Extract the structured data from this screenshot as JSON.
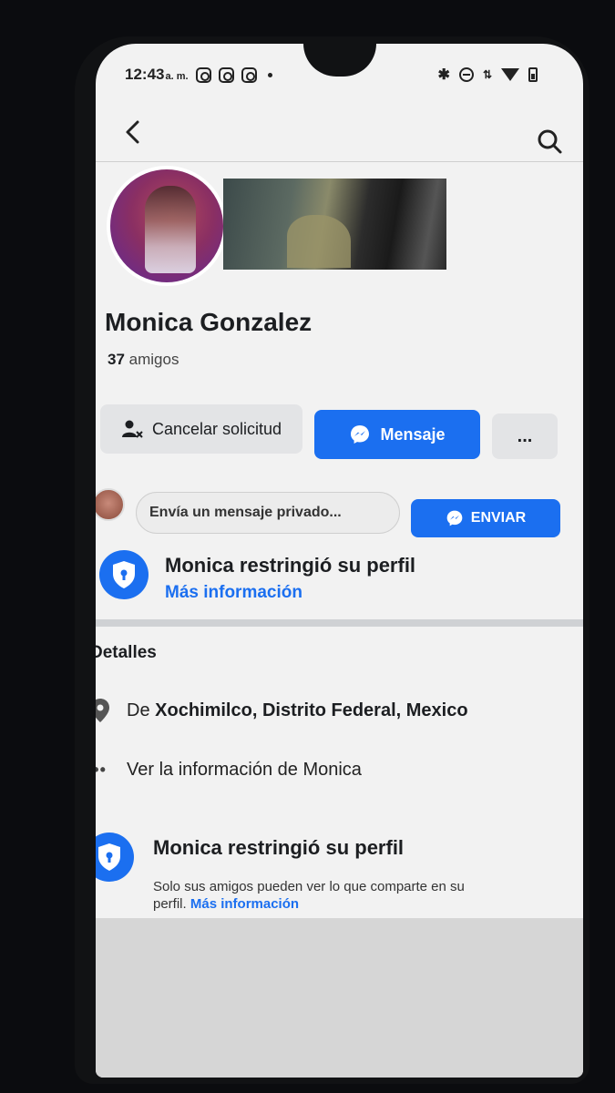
{
  "status_bar": {
    "time": "12:43",
    "ampm": "a. m."
  },
  "profile": {
    "name": "Monica Gonzalez",
    "friends_count": "37",
    "friends_label": "amigos"
  },
  "actions": {
    "cancel_request": "Cancelar solicitud",
    "message": "Mensaje",
    "more": "..."
  },
  "private_message": {
    "placeholder": "Envía un mensaje privado...",
    "send": "ENVIAR"
  },
  "restriction_banner": {
    "title": "Monica restringió su perfil",
    "link": "Más información"
  },
  "details": {
    "title": "Detalles",
    "location_prefix": "De",
    "location": "Xochimilco, Distrito Federal, Mexico",
    "see_info": "Ver la información de Monica"
  },
  "restriction_footer": {
    "title": "Monica restringió su perfil",
    "description": "Solo sus amigos pueden ver lo que comparte en su perfil.",
    "link": "Más información"
  },
  "colors": {
    "accent": "#1b6ff0",
    "background": "#f2f2f2",
    "button_gray": "#e3e4e6"
  }
}
